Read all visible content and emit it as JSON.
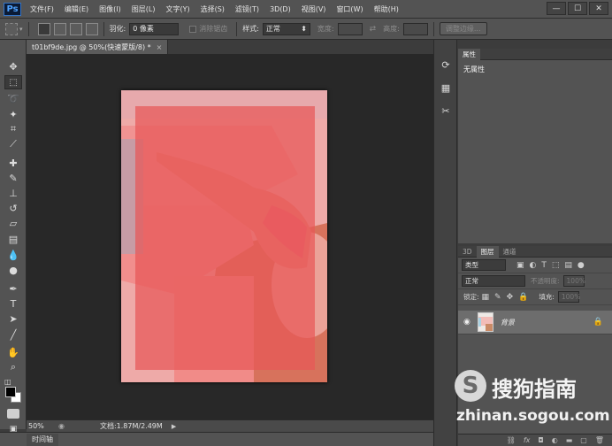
{
  "app": {
    "logo": "Ps",
    "menu": [
      "文件(F)",
      "编辑(E)",
      "图像(I)",
      "图层(L)",
      "文字(Y)",
      "选择(S)",
      "滤镜(T)",
      "3D(D)",
      "视图(V)",
      "窗口(W)",
      "帮助(H)"
    ],
    "window_buttons": [
      "—",
      "☐",
      "✕"
    ]
  },
  "options": {
    "feather_label": "羽化:",
    "feather_value": "0 像素",
    "antialias_label": "消除锯齿",
    "style_label": "样式:",
    "style_value": "正常",
    "width_label": "宽度:",
    "height_label": "高度:",
    "refine_edge": "调整边缘..."
  },
  "document": {
    "tab_title": "t01bf9de.jpg @ 50%(快速蒙版/8) *",
    "close": "×"
  },
  "status": {
    "zoom": "50%",
    "doc_info": "文档:1.87M/2.49M",
    "timeline": "时间轴"
  },
  "properties": {
    "tab": "属性",
    "body": "无属性"
  },
  "layers": {
    "tabs": [
      "3D",
      "图层",
      "通道"
    ],
    "filter_value": "类型",
    "blend_mode": "正常",
    "opacity_label": "不透明度:",
    "opacity_value": "100%",
    "lock_label": "锁定:",
    "fill_label": "填充:",
    "fill_value": "100%",
    "layer_name": "背景"
  },
  "watermark": {
    "logo_letter": "S",
    "title": "搜狗指南",
    "url": "zhinan.sogou.com"
  },
  "colors": {
    "quick_mask_overlay": "#ea5a5a",
    "ui_panel": "#535353",
    "canvas_bg": "#282828"
  }
}
